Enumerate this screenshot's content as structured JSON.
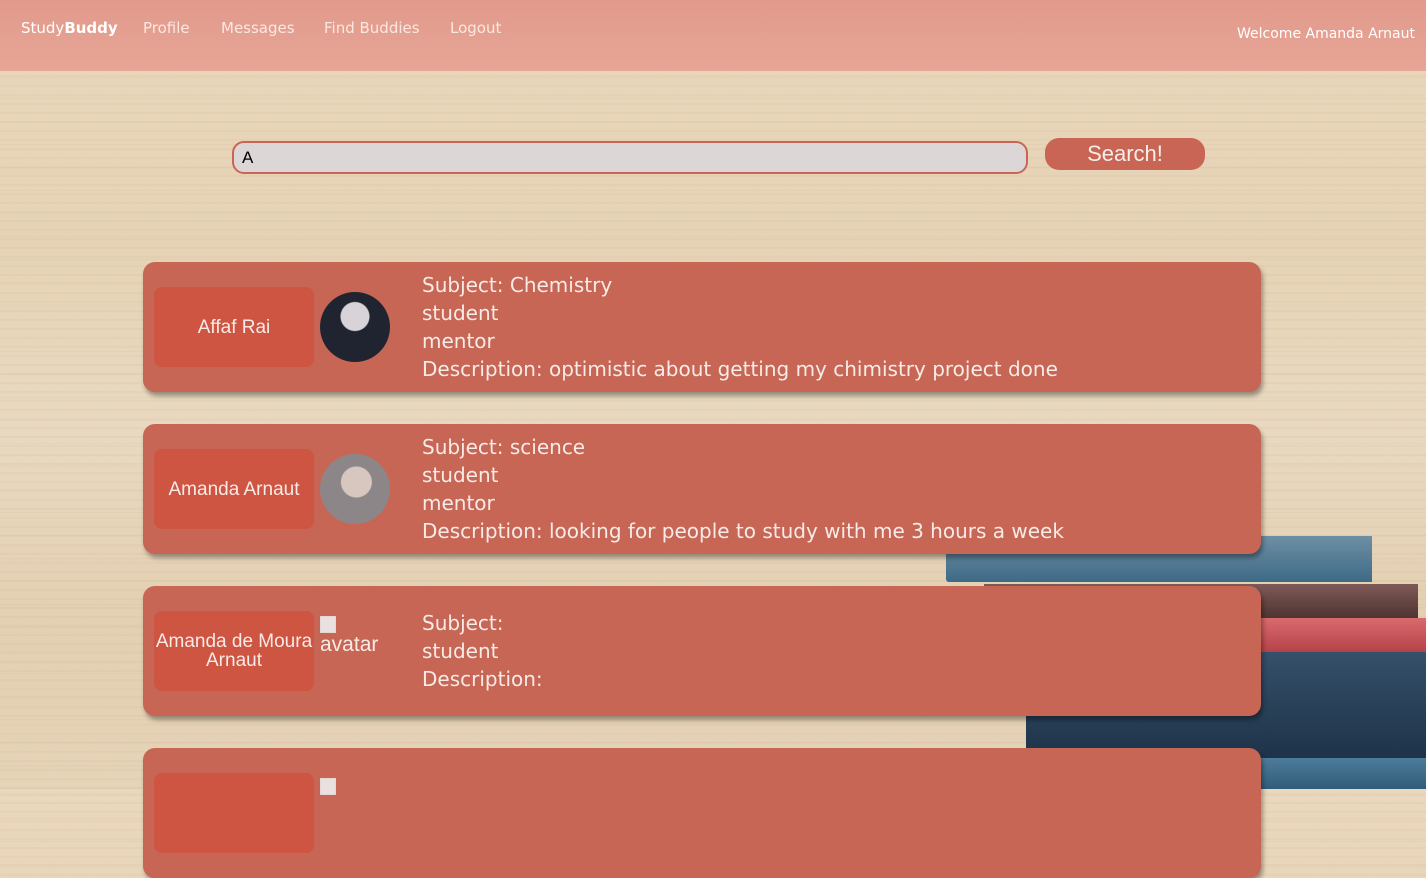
{
  "nav": {
    "brand_prefix": "Study",
    "brand_bold": "Buddy",
    "links": [
      "Profile",
      "Messages",
      "Find Buddies",
      "Logout"
    ],
    "welcome": "Welcome Amanda Arnaut"
  },
  "search": {
    "value": "A",
    "button_label": "Search!"
  },
  "results": [
    {
      "name": "Affaf Rai",
      "subject": "Subject: Chemistry",
      "role1": "student",
      "role2": "mentor",
      "description": "Description: optimistic about getting my chimistry project done"
    },
    {
      "name": "Amanda Arnaut",
      "subject": "Subject: science",
      "role1": "student",
      "role2": "mentor",
      "description": "Description: looking for people to study with me 3 hours a week"
    },
    {
      "name": "Amanda de Moura Arnaut",
      "avatar_alt": "avatar",
      "subject": "Subject:",
      "role1": "student",
      "description": "Description:"
    }
  ],
  "colors": {
    "accent": "#c96554",
    "card": "#c76655",
    "navbar": "#e29a8c"
  }
}
